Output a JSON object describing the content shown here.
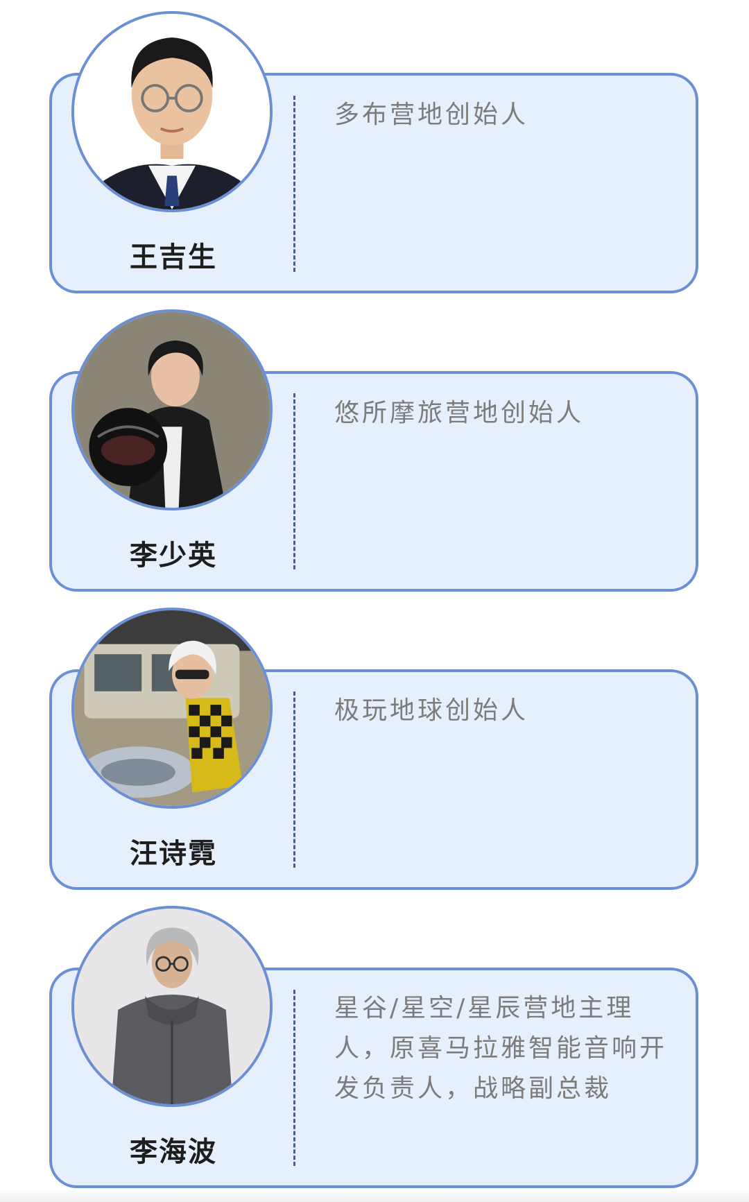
{
  "people": [
    {
      "name": "王吉生",
      "role": "多布营地创始人",
      "avatar_icon": "man-in-suit-avatar"
    },
    {
      "name": "李少英",
      "role": "悠所摩旅营地创始人",
      "avatar_icon": "woman-with-helmet-avatar"
    },
    {
      "name": "汪诗霓",
      "role": "极玩地球创始人",
      "avatar_icon": "woman-on-motorcycle-avatar"
    },
    {
      "name": "李海波",
      "role": "星谷/星空/星辰营地主理人，原喜马拉雅智能音响开发负责人，战略副总裁",
      "avatar_icon": "man-in-hoodie-avatar"
    }
  ],
  "colors": {
    "card_background": "#e5f0fc",
    "card_border": "#6b8fd4",
    "divider": "#3f5f9c",
    "name_text": "#1d1d1d",
    "role_text": "#7c7c7c"
  }
}
